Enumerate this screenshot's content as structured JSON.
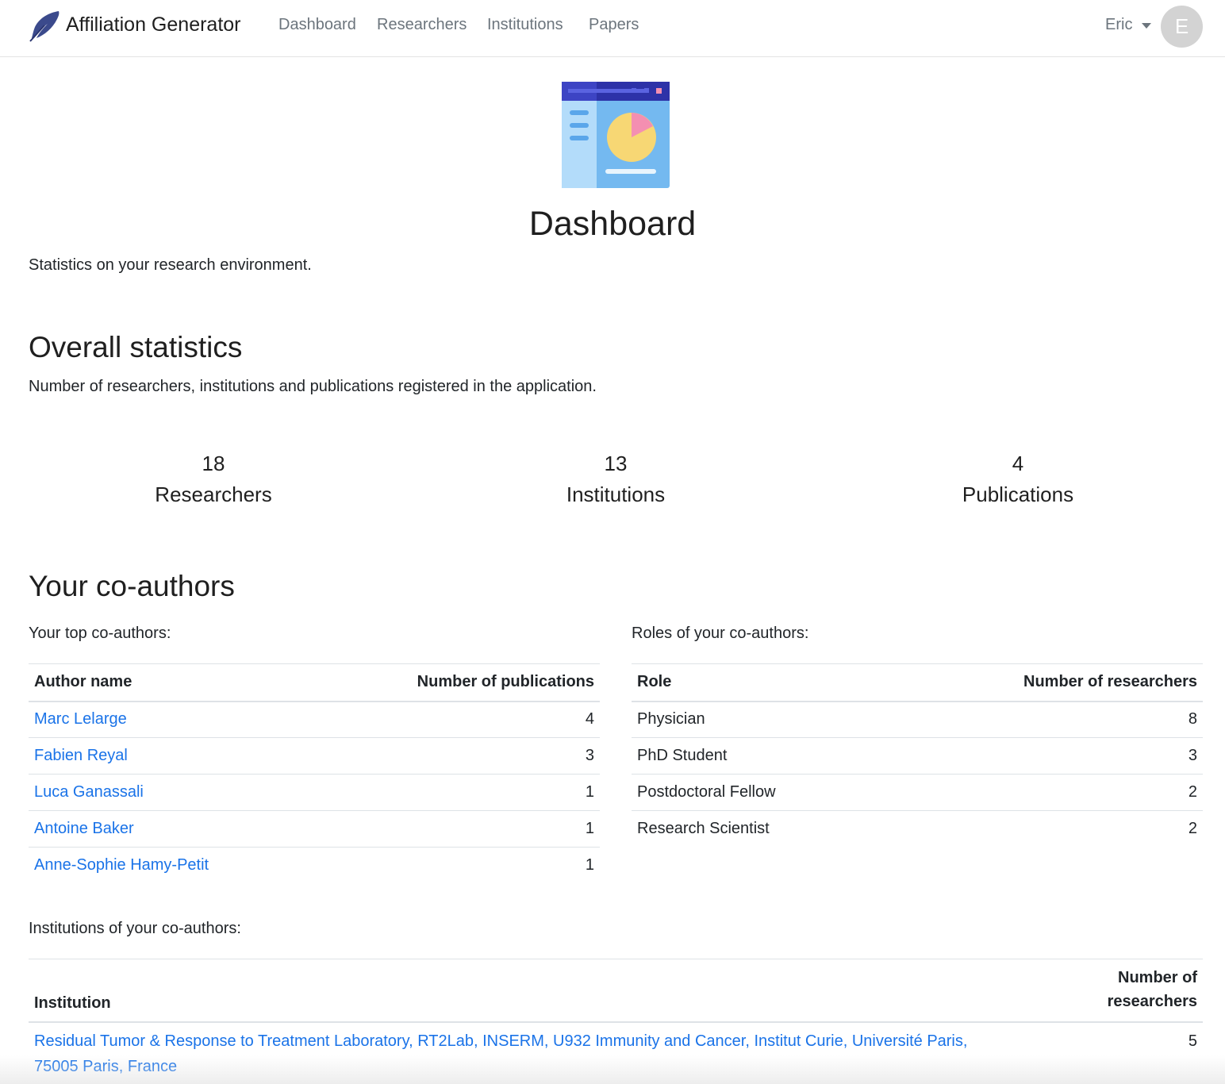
{
  "nav": {
    "brand": "Affiliation Generator",
    "links": [
      "Dashboard",
      "Researchers",
      "Institutions",
      "Papers"
    ],
    "user": "Eric",
    "avatar_letter": "E"
  },
  "hero": {
    "title": "Dashboard",
    "lead": "Statistics on your research environment."
  },
  "overall": {
    "heading": "Overall statistics",
    "description": "Number of researchers, institutions and publications registered in the application.",
    "stats": [
      {
        "value": "18",
        "label": "Researchers"
      },
      {
        "value": "13",
        "label": "Institutions"
      },
      {
        "value": "4",
        "label": "Publications"
      }
    ]
  },
  "coauthors": {
    "heading": "Your co-authors",
    "top_caption": "Your top co-authors:",
    "top_headers": [
      "Author name",
      "Number of publications"
    ],
    "top_rows": [
      {
        "name": "Marc Lelarge",
        "count": "4"
      },
      {
        "name": "Fabien Reyal",
        "count": "3"
      },
      {
        "name": "Luca Ganassali",
        "count": "1"
      },
      {
        "name": "Antoine Baker",
        "count": "1"
      },
      {
        "name": "Anne-Sophie Hamy-Petit",
        "count": "1"
      }
    ],
    "roles_caption": "Roles of your co-authors:",
    "roles_headers": [
      "Role",
      "Number of researchers"
    ],
    "roles_rows": [
      {
        "role": "Physician",
        "count": "8"
      },
      {
        "role": "PhD Student",
        "count": "3"
      },
      {
        "role": "Postdoctoral Fellow",
        "count": "2"
      },
      {
        "role": "Research Scientist",
        "count": "2"
      }
    ],
    "inst_caption": "Institutions of your co-authors:",
    "inst_headers": [
      "Institution",
      "Number of",
      "researchers"
    ],
    "inst_rows": [
      {
        "line1": "Residual Tumor & Response to Treatment Laboratory, RT2Lab, INSERM, U932 Immunity and Cancer, Institut Curie, Université Paris,",
        "line2": "75005 Paris, France",
        "count": "5"
      }
    ]
  }
}
